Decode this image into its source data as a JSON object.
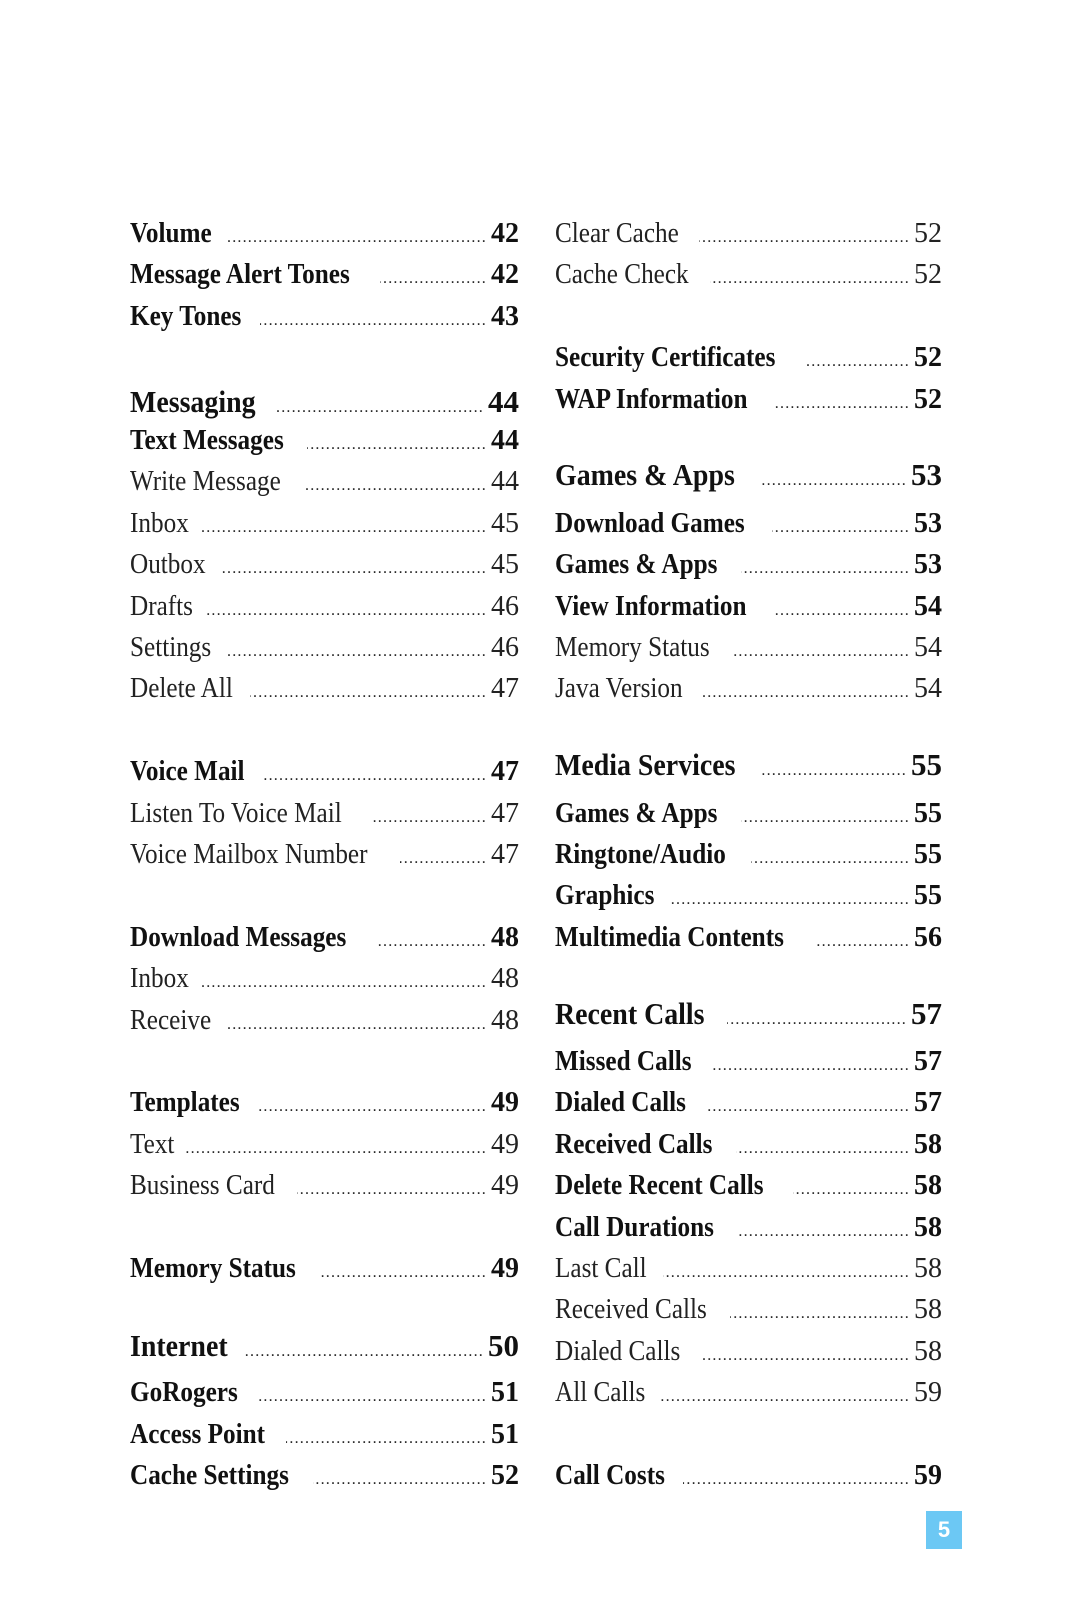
{
  "toc": {
    "left": [
      {
        "label": "Volume",
        "page": "42",
        "style": "bold"
      },
      {
        "label": "Message Alert Tones",
        "page": "42",
        "style": "bold"
      },
      {
        "label": "Key Tones",
        "page": "43",
        "style": "bold"
      },
      null,
      {
        "label": "Messaging",
        "page": "44",
        "style": "section"
      },
      {
        "label": "Text Messages",
        "page": "44",
        "style": "bold"
      },
      {
        "label": "Write Message",
        "page": "44",
        "style": "regular"
      },
      {
        "label": "Inbox",
        "page": "45",
        "style": "regular"
      },
      {
        "label": "Outbox",
        "page": "45",
        "style": "regular"
      },
      {
        "label": "Drafts",
        "page": "46",
        "style": "regular"
      },
      {
        "label": "Settings",
        "page": "46",
        "style": "regular"
      },
      {
        "label": "Delete All",
        "page": "47",
        "style": "regular"
      },
      null,
      {
        "label": "Voice Mail",
        "page": "47",
        "style": "bold"
      },
      {
        "label": "Listen To Voice Mail",
        "page": "47",
        "style": "regular"
      },
      {
        "label": "Voice Mailbox Number",
        "page": "47",
        "style": "regular"
      },
      null,
      {
        "label": "Download Messages",
        "page": "48",
        "style": "bold"
      },
      {
        "label": "Inbox",
        "page": "48",
        "style": "regular"
      },
      {
        "label": "Receive",
        "page": "48",
        "style": "regular"
      },
      null,
      {
        "label": "Templates",
        "page": "49",
        "style": "bold"
      },
      {
        "label": "Text",
        "page": "49",
        "style": "regular"
      },
      {
        "label": "Business Card",
        "page": "49",
        "style": "regular"
      },
      null,
      {
        "label": "Memory Status",
        "page": "49",
        "style": "bold"
      },
      null,
      {
        "label": "Internet",
        "page": "50",
        "style": "section"
      },
      {
        "label": "GoRogers",
        "page": "51",
        "style": "bold"
      },
      {
        "label": "Access Point",
        "page": "51",
        "style": "bold"
      },
      {
        "label": "Cache Settings",
        "page": "52",
        "style": "bold"
      }
    ],
    "right": [
      {
        "label": "Clear Cache",
        "page": "52",
        "style": "regular"
      },
      {
        "label": "Cache Check",
        "page": "52",
        "style": "regular"
      },
      null,
      {
        "label": "Security Certificates",
        "page": "52",
        "style": "bold"
      },
      {
        "label": "WAP Information",
        "page": "52",
        "style": "bold"
      },
      null,
      {
        "label": "Games & Apps",
        "page": "53",
        "style": "section"
      },
      {
        "label": "Download Games",
        "page": "53",
        "style": "bold"
      },
      {
        "label": "Games & Apps",
        "page": "53",
        "style": "bold"
      },
      {
        "label": "View Information",
        "page": "54",
        "style": "bold"
      },
      {
        "label": "Memory Status",
        "page": "54",
        "style": "regular"
      },
      {
        "label": "Java Version",
        "page": "54",
        "style": "regular"
      },
      null,
      {
        "label": "Media Services",
        "page": "55",
        "style": "section"
      },
      {
        "label": "Games & Apps",
        "page": "55",
        "style": "bold"
      },
      {
        "label": "Ringtone/Audio",
        "page": "55",
        "style": "bold"
      },
      {
        "label": "Graphics",
        "page": "55",
        "style": "bold"
      },
      {
        "label": "Multimedia Contents",
        "page": "56",
        "style": "bold"
      },
      null,
      {
        "label": "Recent Calls",
        "page": "57",
        "style": "section"
      },
      {
        "label": "Missed Calls",
        "page": "57",
        "style": "bold"
      },
      {
        "label": "Dialed Calls",
        "page": "57",
        "style": "bold"
      },
      {
        "label": "Received Calls",
        "page": "58",
        "style": "bold"
      },
      {
        "label": "Delete Recent Calls",
        "page": "58",
        "style": "bold"
      },
      {
        "label": "Call Durations",
        "page": "58",
        "style": "bold"
      },
      {
        "label": "Last Call",
        "page": "58",
        "style": "regular"
      },
      {
        "label": "Received Calls",
        "page": "58",
        "style": "regular"
      },
      {
        "label": "Dialed Calls",
        "page": "58",
        "style": "regular"
      },
      {
        "label": "All Calls",
        "page": "59",
        "style": "regular"
      },
      null,
      {
        "label": "Call Costs",
        "page": "59",
        "style": "bold"
      }
    ]
  },
  "footer": {
    "page_number": "5",
    "badge_color": "#6cc8f4"
  }
}
